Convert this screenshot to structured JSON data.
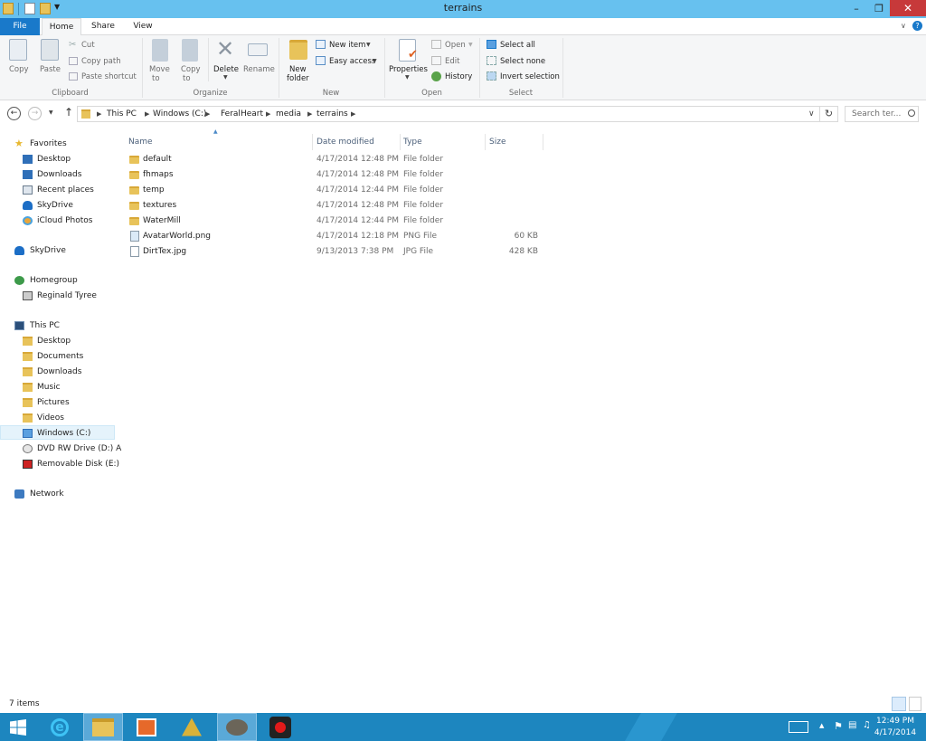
{
  "window": {
    "title": "terrains",
    "controls": {
      "minimize": "–",
      "restore": "❐",
      "close": "✕"
    }
  },
  "tabs": {
    "file": "File",
    "home": "Home",
    "share": "Share",
    "view": "View"
  },
  "ribbon": {
    "clipboard": {
      "copy": "Copy",
      "paste": "Paste",
      "cut": "Cut",
      "copy_path": "Copy path",
      "paste_shortcut": "Paste shortcut",
      "label": "Clipboard"
    },
    "organize": {
      "move_to": "Move",
      "move_to_2": "to",
      "copy_to": "Copy",
      "copy_to_2": "to",
      "delete": "Delete",
      "rename": "Rename",
      "label": "Organize"
    },
    "new": {
      "new_folder": "New",
      "new_folder_2": "folder",
      "new_item": "New item",
      "easy_access": "Easy access",
      "label": "New"
    },
    "open": {
      "properties": "Properties",
      "open": "Open",
      "edit": "Edit",
      "history": "History",
      "label": "Open"
    },
    "select": {
      "select_all": "Select all",
      "select_none": "Select none",
      "invert_selection": "Invert selection",
      "label": "Select"
    }
  },
  "address": {
    "breadcrumbs": [
      "This PC",
      "Windows (C:)",
      "FeralHeart",
      "media",
      "terrains"
    ],
    "search_placeholder": "Search ter..."
  },
  "nav": {
    "favorites": "Favorites",
    "fav_items": [
      "Desktop",
      "Downloads",
      "Recent places",
      "SkyDrive",
      "iCloud Photos"
    ],
    "skydrive": "SkyDrive",
    "homegroup": "Homegroup",
    "homegroup_user": "Reginald Tyree",
    "this_pc": "This PC",
    "pc_items": [
      "Desktop",
      "Documents",
      "Downloads",
      "Music",
      "Pictures",
      "Videos",
      "Windows (C:)",
      "DVD RW Drive (D:) A",
      "Removable Disk (E:)"
    ],
    "network": "Network"
  },
  "columns": {
    "name": "Name",
    "date": "Date modified",
    "type": "Type",
    "size": "Size"
  },
  "files": [
    {
      "name": "default",
      "date": "4/17/2014 12:48 PM",
      "type": "File folder",
      "size": "",
      "kind": "folder"
    },
    {
      "name": "fhmaps",
      "date": "4/17/2014 12:48 PM",
      "type": "File folder",
      "size": "",
      "kind": "folder"
    },
    {
      "name": "temp",
      "date": "4/17/2014 12:44 PM",
      "type": "File folder",
      "size": "",
      "kind": "folder"
    },
    {
      "name": "textures",
      "date": "4/17/2014 12:48 PM",
      "type": "File folder",
      "size": "",
      "kind": "folder"
    },
    {
      "name": "WaterMill",
      "date": "4/17/2014 12:44 PM",
      "type": "File folder",
      "size": "",
      "kind": "folder"
    },
    {
      "name": "AvatarWorld.png",
      "date": "4/17/2014 12:18 PM",
      "type": "PNG File",
      "size": "60 KB",
      "kind": "image"
    },
    {
      "name": "DirtTex.jpg",
      "date": "9/13/2013 7:38 PM",
      "type": "JPG File",
      "size": "428 KB",
      "kind": "file"
    }
  ],
  "status": {
    "items": "7 items"
  },
  "taskbar": {
    "time": "12:49 PM",
    "date": "4/17/2014"
  },
  "colors": {
    "accent": "#1979ca",
    "titlebar": "#67c1ef",
    "taskbar": "#1d86bf",
    "close": "#c7393a"
  }
}
